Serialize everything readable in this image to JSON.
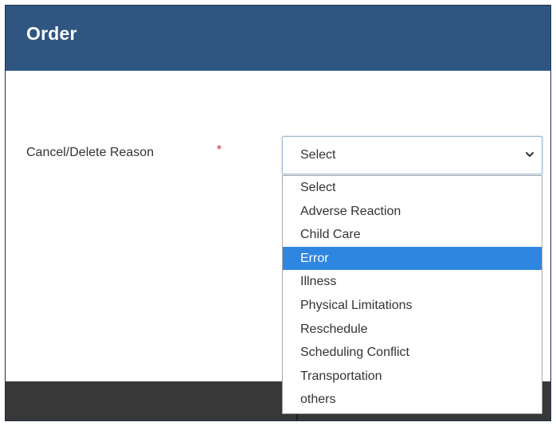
{
  "header": {
    "title": "Order"
  },
  "form": {
    "reason_label": "Cancel/Delete Reason",
    "required_marker": "*",
    "select_value": "Select"
  },
  "dropdown": {
    "highlighted": "Error",
    "options": [
      "Select",
      "Adverse Reaction",
      "Child Care",
      "Error",
      "Illness",
      "Physical Limitations",
      "Reschedule",
      "Scheduling Conflict",
      "Transportation",
      "others"
    ]
  },
  "colors": {
    "header_bg": "#2f5581",
    "highlight": "#2f86e0",
    "required": "#d9263a"
  },
  "icons": {
    "select_arrow": "chevron-down-icon"
  }
}
